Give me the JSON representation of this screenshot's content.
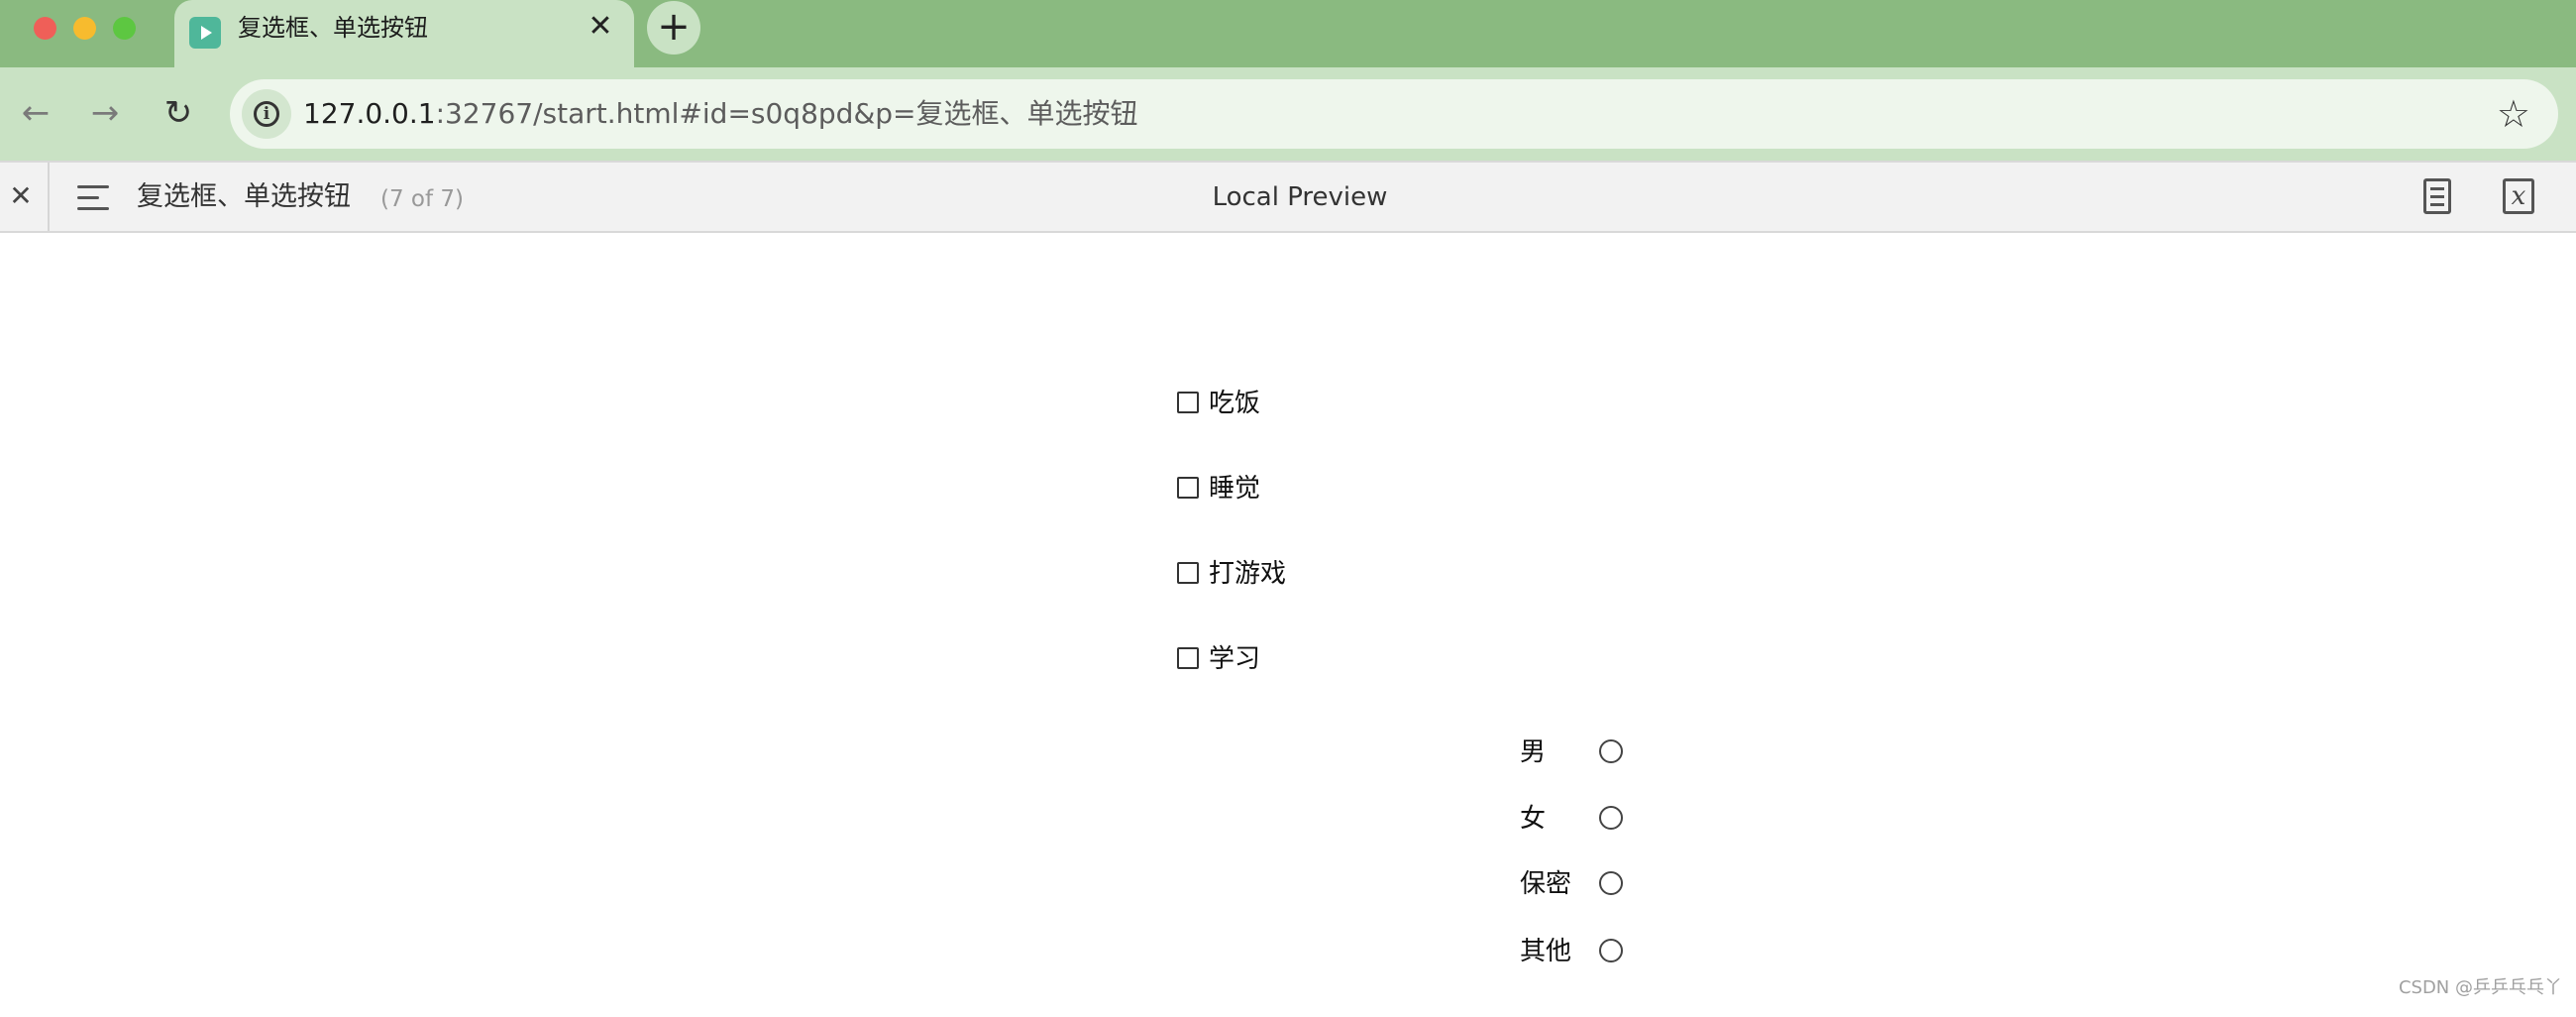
{
  "browser": {
    "tab": {
      "title": "复选框、单选按钮",
      "close_glyph": "✕",
      "favicon": "play-icon"
    },
    "new_tab_glyph": "+",
    "nav": {
      "back_glyph": "←",
      "forward_glyph": "→",
      "reload_glyph": "↻"
    },
    "address": {
      "host": "127.0.0.1",
      "rest": ":32767/start.html#id=s0q8pd&p=复选框、单选按钮",
      "info_glyph": "i"
    },
    "bookmark_glyph": "☆"
  },
  "preview": {
    "close_glyph": "✕",
    "title": "复选框、单选按钮",
    "count": "(7 of 7)",
    "center_label": "Local Preview",
    "formula_glyph": "x"
  },
  "form": {
    "checkboxes": [
      "吃饭",
      "睡觉",
      "打游戏",
      "学习"
    ],
    "radios": [
      "男",
      "女",
      "保密",
      "其他"
    ]
  },
  "watermark": "CSDN @乒乒乓乓丫"
}
